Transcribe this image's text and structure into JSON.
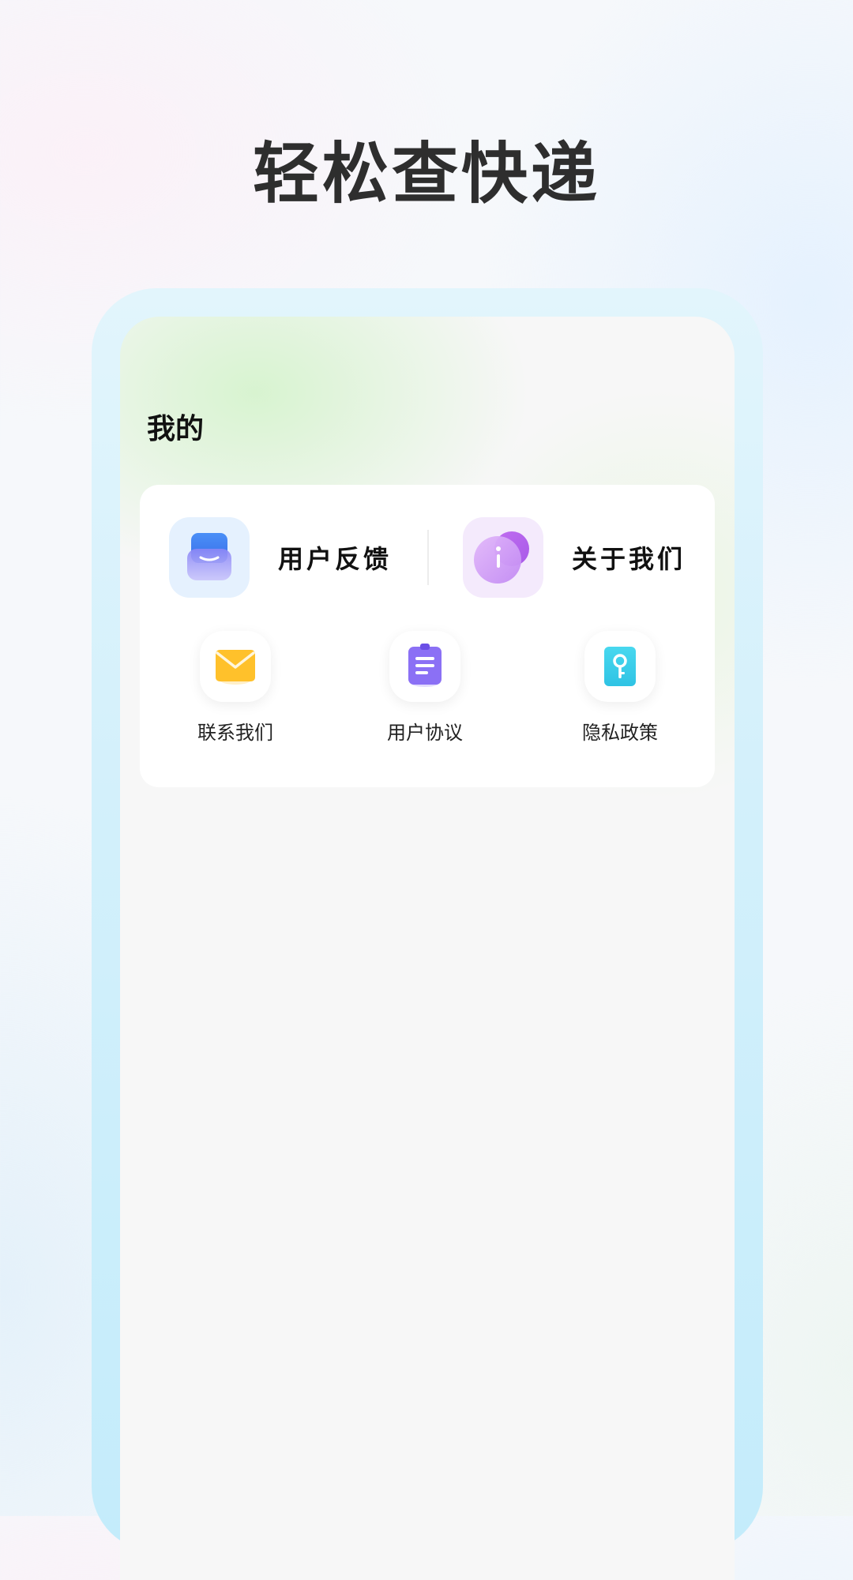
{
  "headline": "轻松查快递",
  "screen": {
    "title": "我的"
  },
  "card": {
    "big_items": [
      {
        "label": "用户反馈",
        "icon": "inbox-tray-icon"
      },
      {
        "label": "关于我们",
        "icon": "info-icon"
      }
    ],
    "small_items": [
      {
        "label": "联系我们",
        "icon": "envelope-icon"
      },
      {
        "label": "用户协议",
        "icon": "clipboard-document-icon"
      },
      {
        "label": "隐私政策",
        "icon": "key-lock-icon"
      }
    ]
  },
  "colors": {
    "frame": "#d3f0fb",
    "feedback_icon_bg": "#e5f1fe",
    "about_icon_bg": "#f4eafc",
    "envelope": "#ffc12b",
    "clipboard": "#8b70f5",
    "key_lock": "#3fd2ea"
  }
}
